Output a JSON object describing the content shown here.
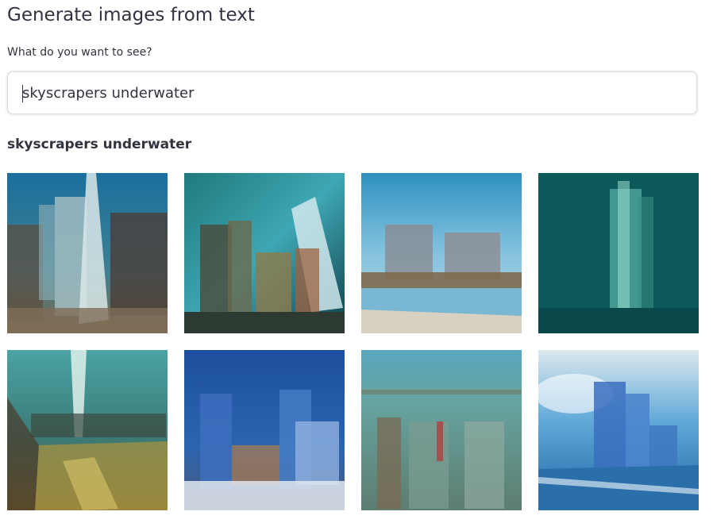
{
  "page": {
    "title": "Generate images from text",
    "prompt_label": "What do you want to see?",
    "input_value": "skyscrapers underwater",
    "result_heading": "skyscrapers underwater"
  },
  "colors": {
    "text": "#31333f",
    "input_border": "#dcdde3"
  },
  "images": [
    {
      "name": "generated-image-1"
    },
    {
      "name": "generated-image-2"
    },
    {
      "name": "generated-image-3"
    },
    {
      "name": "generated-image-4"
    },
    {
      "name": "generated-image-5"
    },
    {
      "name": "generated-image-6"
    },
    {
      "name": "generated-image-7"
    },
    {
      "name": "generated-image-8"
    }
  ]
}
